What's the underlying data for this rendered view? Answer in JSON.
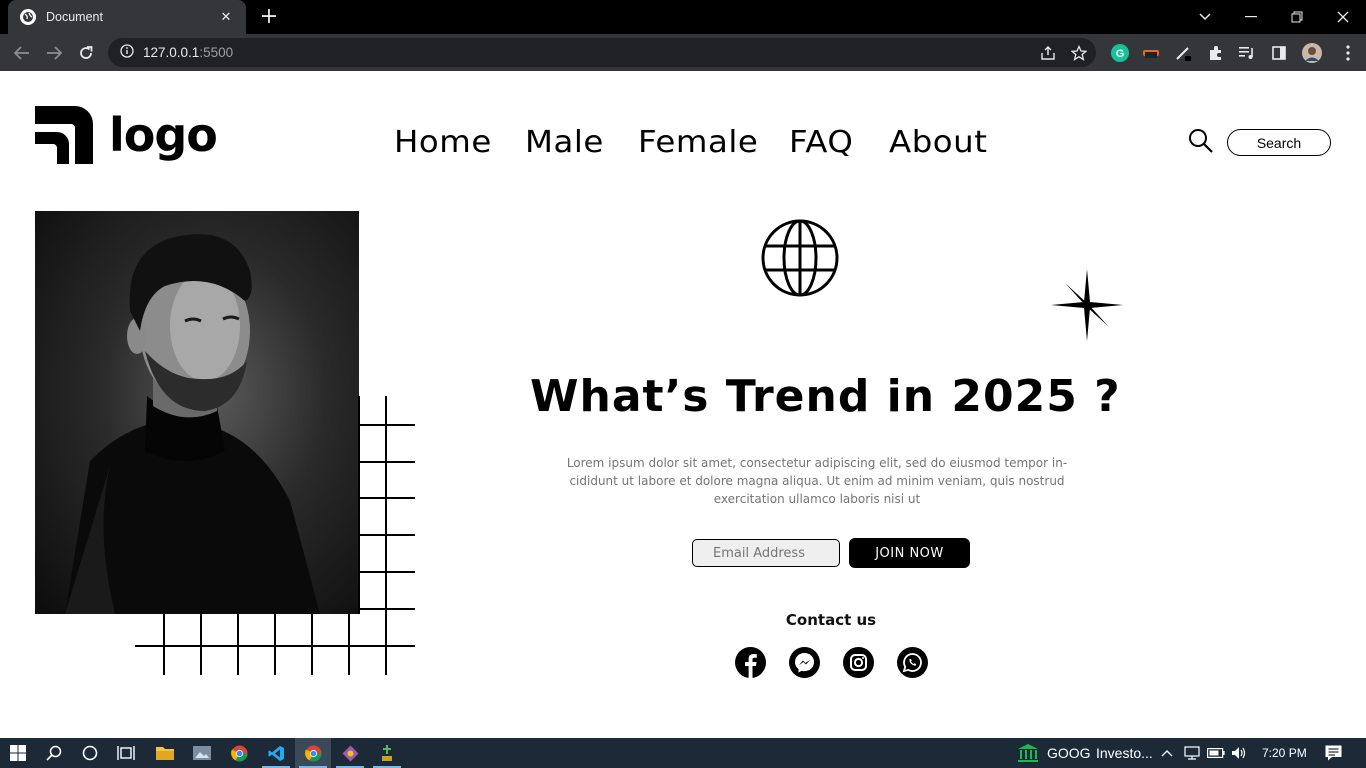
{
  "browser": {
    "tab_title": "Document",
    "url_host": "127.0.0.1",
    "url_port": ":5500"
  },
  "site": {
    "logo_text": "logo",
    "nav": [
      {
        "label": "Home"
      },
      {
        "label": "Male"
      },
      {
        "label": "Female"
      },
      {
        "label": "FAQ"
      },
      {
        "label": "About"
      }
    ],
    "search_label": "Search"
  },
  "hero": {
    "headline": "What’s Trend in 2025 ?",
    "lorem": "Lorem ipsum dolor sit amet, consectetur adipiscing elit, sed do eiusmod tempor in- cididunt ut labore et dolore magna aliqua. Ut enim ad minim veniam, quis nostrud exercitation ullamco laboris nisi ut",
    "email_placeholder": "Email Address",
    "join_label": "JOIN NOW",
    "contact_label": "Contact us",
    "social": [
      "facebook-icon",
      "messenger-icon",
      "instagram-icon",
      "whatsapp-icon"
    ]
  },
  "taskbar": {
    "stock_label": "GOOG",
    "stock_text": "Investo...",
    "clock": "7:20 PM"
  }
}
